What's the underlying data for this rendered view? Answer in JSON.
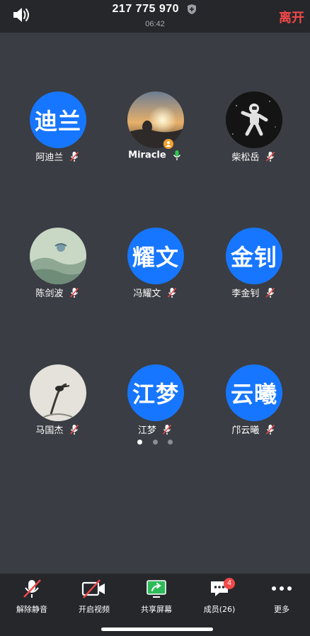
{
  "header": {
    "meeting_id": "217 775 970",
    "timer": "06:42",
    "leave_label": "离开",
    "speaker_icon": "speaker-icon",
    "shield_icon": "shield-icon"
  },
  "participants": [
    {
      "name": "阿迪兰",
      "initials": "迪兰",
      "avatar": "initials",
      "mic": "muted"
    },
    {
      "name": "Miracle",
      "initials": "",
      "avatar": "photo-sunset",
      "mic": "active",
      "host": true
    },
    {
      "name": "柴松岳",
      "initials": "",
      "avatar": "photo-astronaut",
      "mic": "muted"
    },
    {
      "name": "陈剑波",
      "initials": "",
      "avatar": "photo-landscape",
      "mic": "muted"
    },
    {
      "name": "冯耀文",
      "initials": "耀文",
      "avatar": "initials",
      "mic": "muted"
    },
    {
      "name": "李金钊",
      "initials": "金钊",
      "avatar": "initials",
      "mic": "muted"
    },
    {
      "name": "马国杰",
      "initials": "",
      "avatar": "photo-ink-bird",
      "mic": "muted"
    },
    {
      "name": "江梦",
      "initials": "江梦",
      "avatar": "initials",
      "mic": "muted"
    },
    {
      "name": "邝云曦",
      "initials": "云曦",
      "avatar": "initials",
      "mic": "muted"
    }
  ],
  "pagination": {
    "pages": 3,
    "current": 1
  },
  "toolbar": {
    "unmute_label": "解除静音",
    "video_label": "开启视频",
    "share_label": "共享屏幕",
    "members_label": "成员(26)",
    "members_badge": "4",
    "more_label": "更多"
  },
  "colors": {
    "background": "#3a3d43",
    "bar": "#25272b",
    "avatar_blue": "#1776ff",
    "leave_red": "#f24848",
    "mic_green": "#2dc84d",
    "share_green": "#2dbb5a",
    "host_orange": "#f4a12d"
  }
}
